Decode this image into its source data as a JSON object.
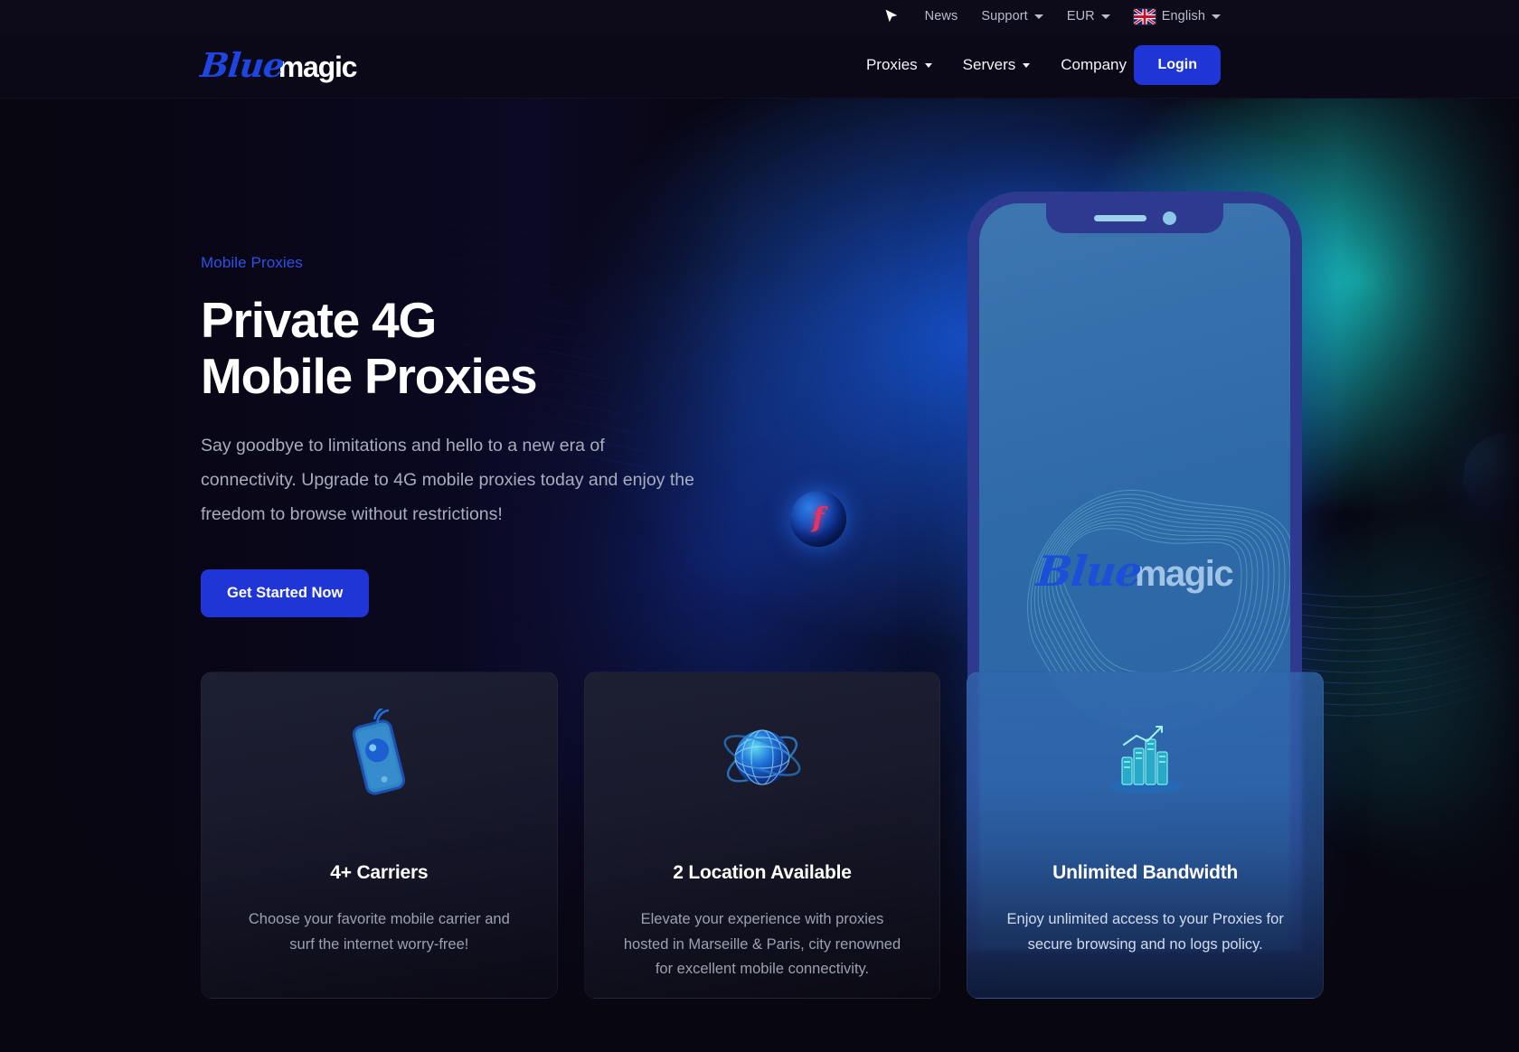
{
  "topbar": {
    "cursor_icon": "cursor-pointer-icon",
    "links": [
      {
        "label": "News",
        "has_caret": false
      },
      {
        "label": "Support",
        "has_caret": true
      },
      {
        "label": "EUR",
        "has_caret": true
      }
    ],
    "language": {
      "label": "English",
      "flag": "uk-flag-icon"
    }
  },
  "header": {
    "logo": {
      "part1": "Blue",
      "part2": "magic"
    },
    "nav": [
      {
        "label": "Proxies"
      },
      {
        "label": "Servers"
      },
      {
        "label": "Company"
      }
    ],
    "login_label": "Login"
  },
  "hero": {
    "eyebrow": "Mobile Proxies",
    "title": "Private 4G Mobile Proxies",
    "subtitle": "Say goodbye to limitations and hello to a new era of connectivity. Upgrade to 4G mobile proxies today and enjoy the freedom to browse without restrictions!",
    "cta_label": "Get Started Now",
    "phone_logo": {
      "part1": "Blue",
      "part2": "magic"
    },
    "orb_glyph": "f"
  },
  "cards": [
    {
      "icon": "mobile-phone-signal-icon",
      "title": "4+ Carriers",
      "description": "Choose your favorite mobile carrier and surf the internet worry-free!"
    },
    {
      "icon": "globe-network-icon",
      "title": "2 Location Available",
      "description": "Elevate your experience with proxies hosted in Marseille & Paris, city renowned for excellent mobile connectivity."
    },
    {
      "icon": "server-stack-icon",
      "title": "Unlimited Bandwidth",
      "description": "Enjoy unlimited access to your Proxies for secure browsing and no logs policy."
    }
  ],
  "colors": {
    "accent_blue": "#1f35d6",
    "eyebrow_blue": "#2b52e6",
    "page_bg": "#08060f",
    "card_bg": "#1d1f33",
    "text_muted": "#a8adbe"
  }
}
